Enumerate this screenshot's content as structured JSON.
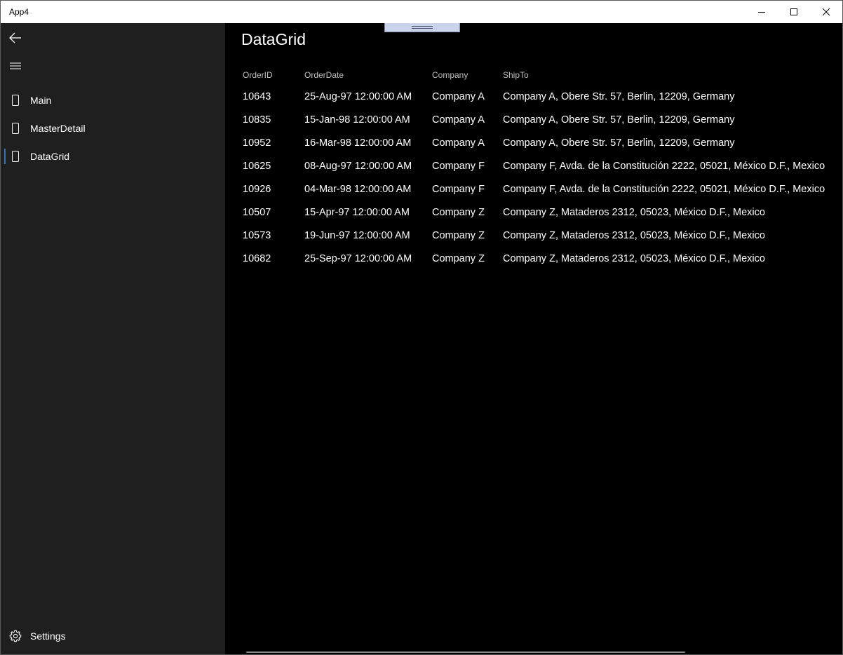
{
  "window": {
    "title": "App4"
  },
  "nav": {
    "items": [
      {
        "label": "Main",
        "icon": "page-icon"
      },
      {
        "label": "MasterDetail",
        "icon": "page-icon"
      },
      {
        "label": "DataGrid",
        "icon": "page-icon",
        "selected": true
      }
    ],
    "settings": {
      "label": "Settings",
      "icon": "gear-icon"
    },
    "accent": "#3a6fb0"
  },
  "page": {
    "title": "DataGrid"
  },
  "grid": {
    "columns": [
      "OrderID",
      "OrderDate",
      "Company",
      "ShipTo"
    ],
    "rows": [
      [
        "10643",
        "25-Aug-97 12:00:00 AM",
        "Company A",
        "Company A, Obere Str. 57, Berlin, 12209, Germany"
      ],
      [
        "10835",
        "15-Jan-98 12:00:00 AM",
        "Company A",
        "Company A, Obere Str. 57, Berlin, 12209, Germany"
      ],
      [
        "10952",
        "16-Mar-98 12:00:00 AM",
        "Company A",
        "Company A, Obere Str. 57, Berlin, 12209, Germany"
      ],
      [
        "10625",
        "08-Aug-97 12:00:00 AM",
        "Company F",
        "Company F, Avda. de la Constitución 2222, 05021, México D.F., Mexico"
      ],
      [
        "10926",
        "04-Mar-98 12:00:00 AM",
        "Company F",
        "Company F, Avda. de la Constitución 2222, 05021, México D.F., Mexico"
      ],
      [
        "10507",
        "15-Apr-97 12:00:00 AM",
        "Company Z",
        "Company Z, Mataderos  2312, 05023, México D.F., Mexico"
      ],
      [
        "10573",
        "19-Jun-97 12:00:00 AM",
        "Company Z",
        "Company Z, Mataderos  2312, 05023, México D.F., Mexico"
      ],
      [
        "10682",
        "25-Sep-97 12:00:00 AM",
        "Company Z",
        "Company Z, Mataderos  2312, 05023, México D.F., Mexico"
      ]
    ]
  }
}
